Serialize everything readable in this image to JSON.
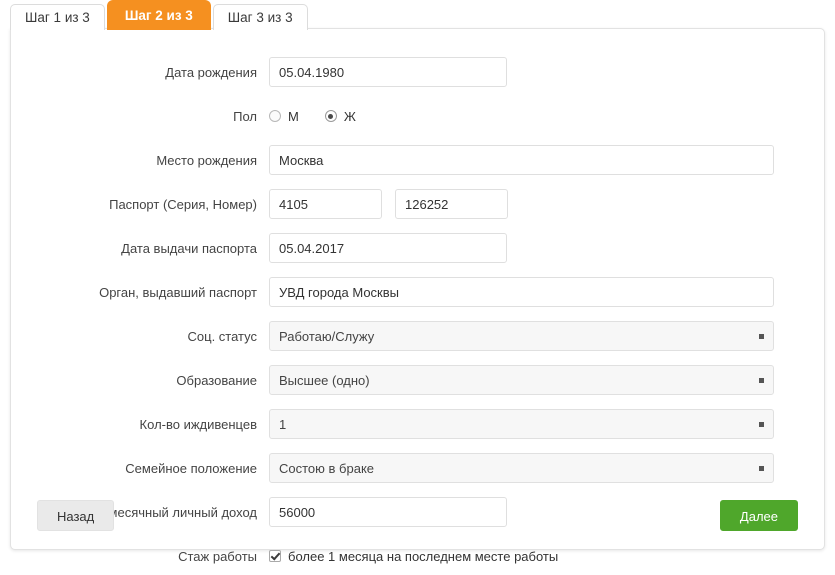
{
  "tabs": [
    {
      "label": "Шаг 1 из 3",
      "active": false
    },
    {
      "label": "Шаг 2 из 3",
      "active": true
    },
    {
      "label": "Шаг 3 из 3",
      "active": false
    }
  ],
  "form": {
    "birth_date": {
      "label": "Дата рождения",
      "value": "05.04.1980"
    },
    "gender": {
      "label": "Пол",
      "options": [
        {
          "label": "М",
          "selected": false
        },
        {
          "label": "Ж",
          "selected": true
        }
      ]
    },
    "birth_place": {
      "label": "Место рождения",
      "value": "Москва"
    },
    "passport": {
      "label": "Паспорт (Серия, Номер)",
      "series": "4105",
      "number": "126252"
    },
    "passport_date": {
      "label": "Дата выдачи паспорта",
      "value": "05.04.2017"
    },
    "passport_authority": {
      "label": "Орган, выдавший паспорт",
      "value": "УВД города Москвы"
    },
    "social_status": {
      "label": "Соц. статус",
      "value": "Работаю/Служу"
    },
    "education": {
      "label": "Образование",
      "value": "Высшее (одно)"
    },
    "dependents": {
      "label": "Кол-во иждивенцев",
      "value": "1"
    },
    "marital_status": {
      "label": "Семейное положение",
      "value": "Состою в браке"
    },
    "income": {
      "label": "Ежемесячный личный доход",
      "value": "56000"
    },
    "experience": {
      "label": "Стаж работы",
      "checkbox_label": "более 1 месяца на последнем месте работы",
      "checked": true
    }
  },
  "footer": {
    "back_label": "Назад",
    "next_label": "Далее"
  },
  "colors": {
    "accent_orange": "#f59020",
    "primary_green": "#4fa72b",
    "select_bg": "#f7f7f7",
    "border": "#dfdfdf"
  }
}
